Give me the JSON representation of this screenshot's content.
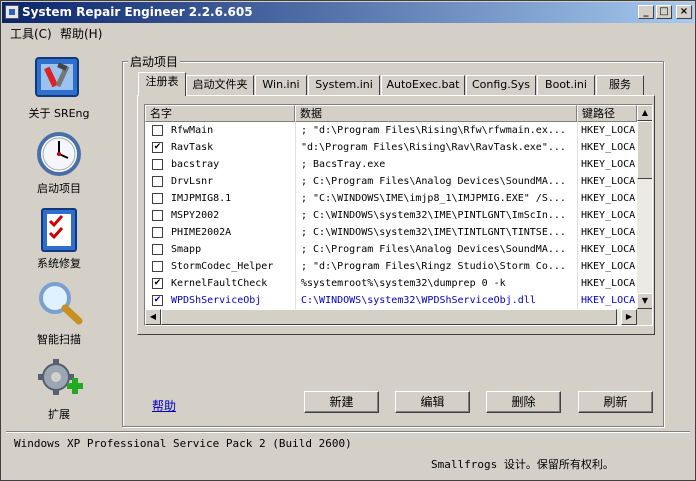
{
  "window": {
    "title": "System Repair Engineer 2.2.6.605",
    "min_glyph": "_",
    "max_glyph": "□",
    "close_glyph": "×"
  },
  "menu": [
    {
      "label": "工具(C)"
    },
    {
      "label": "帮助(H)"
    }
  ],
  "sidebar": {
    "items": [
      {
        "label": "关于 SREng",
        "icon": "toolbox-icon"
      },
      {
        "label": "启动项目",
        "icon": "clock-icon"
      },
      {
        "label": "系统修复",
        "icon": "checklist-icon"
      },
      {
        "label": "智能扫描",
        "icon": "magnifier-icon"
      },
      {
        "label": "扩展",
        "icon": "gear-plus-icon"
      }
    ]
  },
  "group": {
    "title": "启动项目"
  },
  "tabs": [
    {
      "label": "注册表",
      "active": true
    },
    {
      "label": "启动文件夹"
    },
    {
      "label": "Win.ini"
    },
    {
      "label": "System.ini"
    },
    {
      "label": "AutoExec.bat"
    },
    {
      "label": "Config.Sys"
    },
    {
      "label": "Boot.ini"
    },
    {
      "label": "服务"
    }
  ],
  "list": {
    "columns": [
      "名字",
      "数据",
      "键路径"
    ],
    "rows": [
      {
        "checked": false,
        "name": "RfwMain",
        "data": "; \"d:\\Program Files\\Rising\\Rfw\\rfwmain.ex...",
        "key": "HKEY_LOCA"
      },
      {
        "checked": true,
        "name": "RavTask",
        "data": "\"d:\\Program Files\\Rising\\Rav\\RavTask.exe\"...",
        "key": "HKEY_LOCA"
      },
      {
        "checked": false,
        "name": "bacstray",
        "data": "; BacsTray.exe",
        "key": "HKEY_LOCA"
      },
      {
        "checked": false,
        "name": "DrvLsnr",
        "data": "; C:\\Program Files\\Analog Devices\\SoundMA...",
        "key": "HKEY_LOCA"
      },
      {
        "checked": false,
        "name": "IMJPMIG8.1",
        "data": "; \"C:\\WINDOWS\\IME\\imjp8_1\\IMJPMIG.EXE\" /S...",
        "key": "HKEY_LOCA"
      },
      {
        "checked": false,
        "name": "MSPY2002",
        "data": "; C:\\WINDOWS\\system32\\IME\\PINTLGNT\\ImScIn...",
        "key": "HKEY_LOCA"
      },
      {
        "checked": false,
        "name": "PHIME2002A",
        "data": "; C:\\WINDOWS\\system32\\IME\\TINTLGNT\\TINTSE...",
        "key": "HKEY_LOCA"
      },
      {
        "checked": false,
        "name": "Smapp",
        "data": "; C:\\Program Files\\Analog Devices\\SoundMA...",
        "key": "HKEY_LOCA"
      },
      {
        "checked": false,
        "name": "StormCodec_Helper",
        "data": "; \"d:\\Program Files\\Ringz Studio\\Storm Co...",
        "key": "HKEY_LOCA"
      },
      {
        "checked": true,
        "name": "KernelFaultCheck",
        "data": "%systemroot%\\system32\\dumprep 0 -k",
        "key": "HKEY_LOCA"
      },
      {
        "checked": true,
        "name": "WPDShServiceObj",
        "data": "C:\\WINDOWS\\system32\\WPDShServiceObj.dll",
        "key": "HKEY_LOCA",
        "highlight": true
      }
    ]
  },
  "actions": {
    "help": "帮助",
    "new": "新建",
    "edit": "编辑",
    "delete": "删除",
    "refresh": "刷新"
  },
  "status": {
    "os": "Windows XP Professional Service Pack 2 (Build 2600)",
    "copyright": "Smallfrogs 设计。保留所有权利。"
  },
  "check_glyph": "✔"
}
